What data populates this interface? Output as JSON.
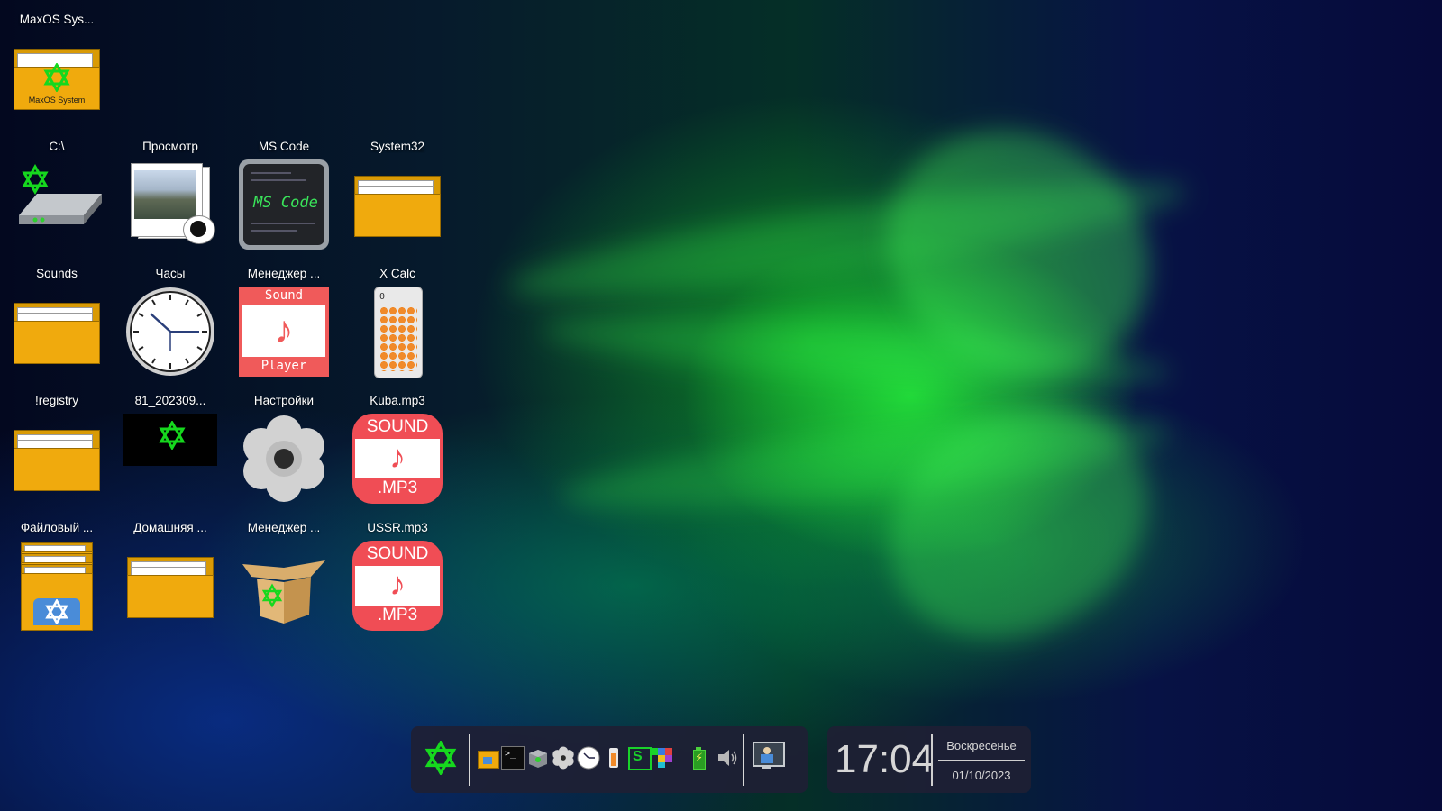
{
  "desktop": {
    "icons": [
      {
        "label": "MaxOS Sys...",
        "sublabel": "MaxOS System",
        "kind": "folder-system"
      },
      {
        "label": "C:\\",
        "kind": "drive"
      },
      {
        "label": "Просмотр",
        "kind": "image-viewer"
      },
      {
        "label": "MS Code",
        "sublabel": "MS Code",
        "kind": "code-editor"
      },
      {
        "label": "System32",
        "kind": "folder"
      },
      {
        "label": "Sounds",
        "kind": "folder"
      },
      {
        "label": "Часы",
        "kind": "clock"
      },
      {
        "label": "Менеджер ...",
        "sublabel_top": "Sound",
        "sublabel_bottom": "Player",
        "kind": "sound-player"
      },
      {
        "label": "X Calc",
        "display": "0",
        "kind": "calculator"
      },
      {
        "label": "!registry",
        "kind": "folder"
      },
      {
        "label": "81_202309...",
        "kind": "image-file"
      },
      {
        "label": "Настройки",
        "kind": "settings"
      },
      {
        "label": "Kuba.mp3",
        "sublabel_top": "SOUND",
        "sublabel_bottom": ".MP3",
        "kind": "mp3"
      },
      {
        "label": "Файловый ...",
        "kind": "file-manager"
      },
      {
        "label": "Домашняя ...",
        "kind": "folder"
      },
      {
        "label": "Менеджер ...",
        "kind": "package-manager"
      },
      {
        "label": "USSR.mp3",
        "sublabel_top": "SOUND",
        "sublabel_bottom": ".MP3",
        "kind": "mp3"
      }
    ]
  },
  "taskbar": {
    "items": [
      "star-menu-icon",
      "file-manager-icon",
      "terminal-icon",
      "package-icon",
      "settings-gear-icon",
      "clock-icon",
      "calculator-icon",
      "code-icon",
      "tetris-icon",
      "battery-icon",
      "volume-icon",
      "display-monitor-icon"
    ]
  },
  "clock": {
    "time": "17:04",
    "day": "Воскресенье",
    "date": "01/10/2023"
  },
  "colors": {
    "accent_green": "#16d81e",
    "folder_yellow": "#f0aa0d",
    "taskbar_bg": "#1e2034"
  }
}
